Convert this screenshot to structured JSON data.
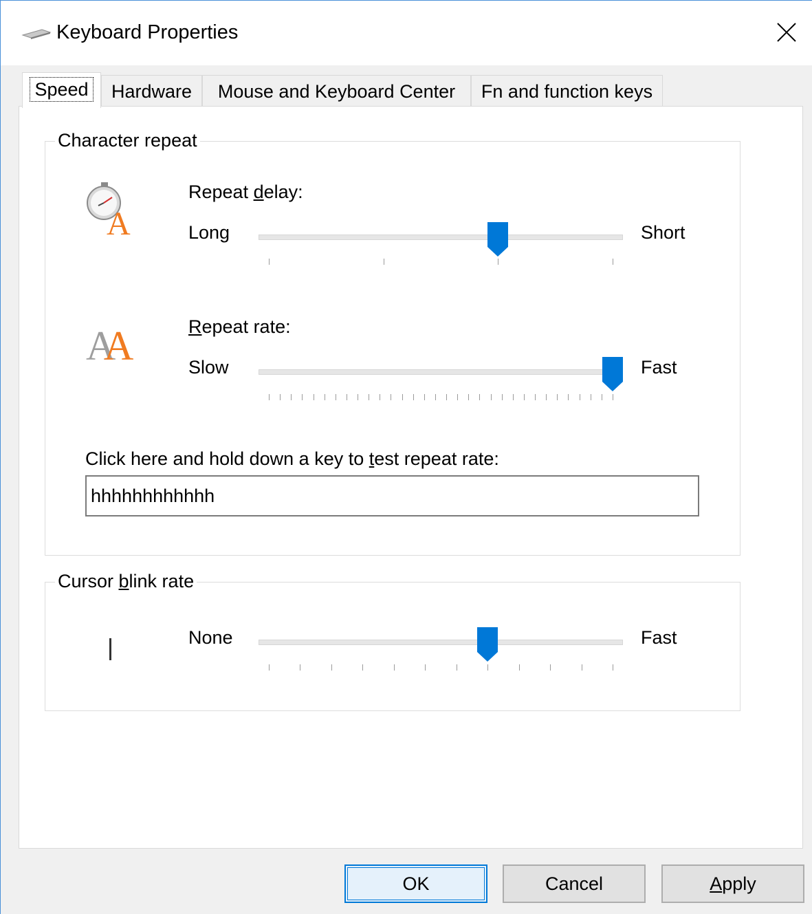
{
  "window": {
    "title": "Keyboard Properties",
    "close_glyph": "✕"
  },
  "tabs": [
    {
      "label": "Speed",
      "active": true
    },
    {
      "label": "Hardware",
      "active": false
    },
    {
      "label": "Mouse and Keyboard Center",
      "active": false
    },
    {
      "label": "Fn and function keys",
      "active": false
    }
  ],
  "character_repeat": {
    "group_label": "Character repeat",
    "repeat_delay": {
      "label_pre": "Repeat ",
      "label_ul": "d",
      "label_post": "elay:",
      "min_label": "Long",
      "max_label": "Short",
      "value": 2,
      "min": 0,
      "max": 3,
      "icon": "stopwatch-letter-icon"
    },
    "repeat_rate": {
      "label_ul": "R",
      "label_post": "epeat rate:",
      "min_label": "Slow",
      "max_label": "Fast",
      "value": 31,
      "min": 0,
      "max": 31,
      "icon": "double-letter-icon"
    },
    "test_prompt_pre": "Click here and hold down a key to ",
    "test_prompt_ul": "t",
    "test_prompt_post": "est repeat rate:",
    "test_value": "hhhhhhhhhhhh"
  },
  "cursor_blink": {
    "group_label_pre": "Cursor ",
    "group_label_ul": "b",
    "group_label_post": "link rate",
    "min_label": "None",
    "max_label": "Fast",
    "value": 7,
    "min": 0,
    "max": 11,
    "icon": "cursor-bar-icon"
  },
  "buttons": {
    "ok": "OK",
    "cancel": "Cancel",
    "apply_ul": "A",
    "apply_post": "pply"
  },
  "colors": {
    "accent": "#0078d7",
    "icon_orange": "#f07b21",
    "icon_gray": "#9e9e9e"
  }
}
